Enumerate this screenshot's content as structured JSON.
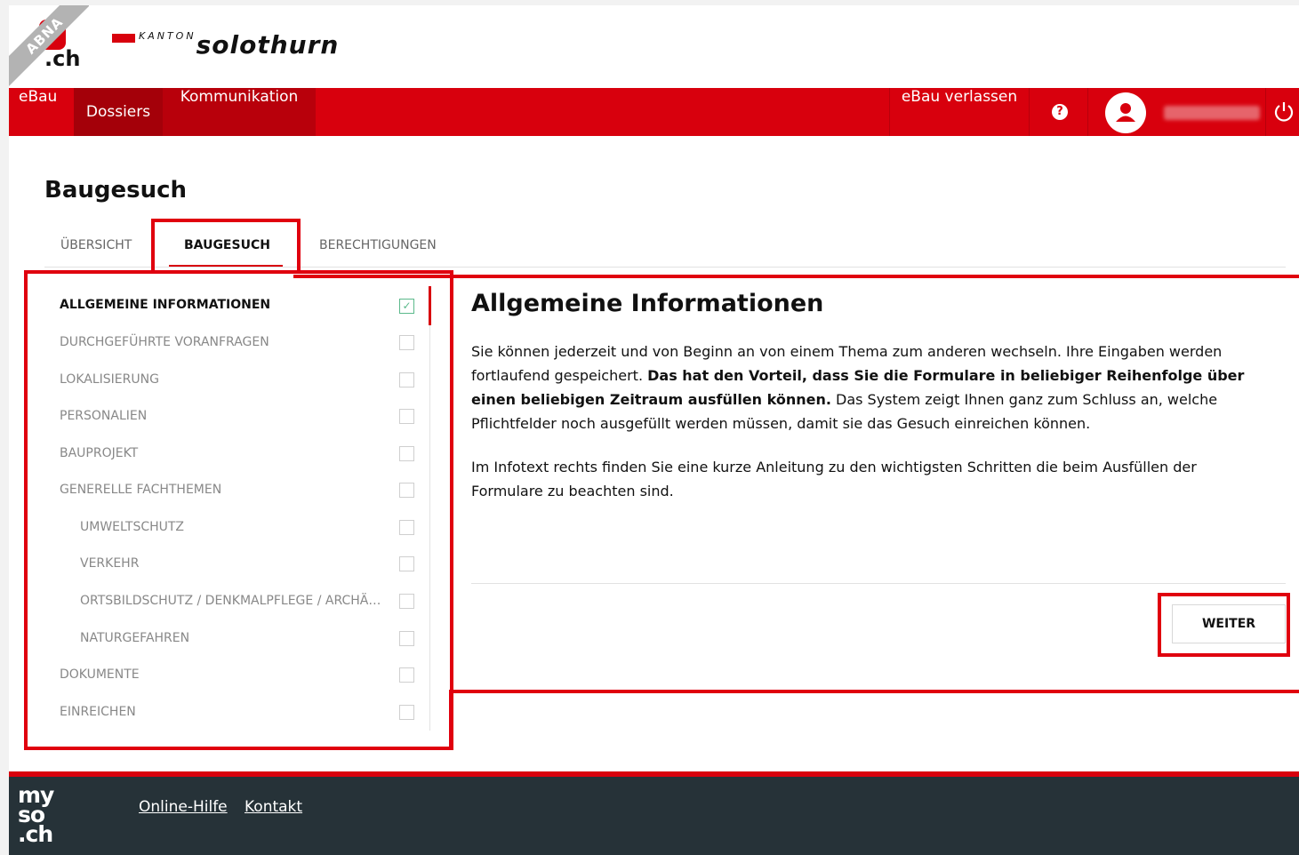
{
  "header": {
    "ribbon": "ABNA",
    "logo_suffix": ".ch",
    "kanton_small": "KANTON",
    "kanton_name": "solothurn"
  },
  "topnav": {
    "ebau": "eBau",
    "dossiers": "Dossiers",
    "kommunikation": "Kommunikation",
    "leave": "eBau verlassen",
    "help": "?"
  },
  "page": {
    "title": "Baugesuch",
    "tabs": [
      "ÜBERSICHT",
      "BAUGESUCH",
      "BERECHTIGUNGEN"
    ]
  },
  "sidebar": {
    "items": [
      {
        "label": "ALLGEMEINE INFORMATIONEN",
        "checked": true
      },
      {
        "label": "DURCHGEFÜHRTE VORANFRAGEN",
        "checked": false
      },
      {
        "label": "LOKALISIERUNG",
        "checked": false
      },
      {
        "label": "PERSONALIEN",
        "checked": false
      },
      {
        "label": "BAUPROJEKT",
        "checked": false
      },
      {
        "label": "GENERELLE FACHTHEMEN",
        "checked": false
      },
      {
        "label": "UMWELTSCHUTZ",
        "checked": false
      },
      {
        "label": "VERKEHR",
        "checked": false
      },
      {
        "label": "ORTSBILDSCHUTZ / DENKMALPFLEGE / ARCHÄ…",
        "checked": false
      },
      {
        "label": "NATURGEFAHREN",
        "checked": false
      },
      {
        "label": "DOKUMENTE",
        "checked": false
      },
      {
        "label": "EINREICHEN",
        "checked": false
      }
    ]
  },
  "content": {
    "title": "Allgemeine Informationen",
    "p1_start": "Sie können jederzeit und von Beginn an von einem Thema zum anderen wechseln. Ihre Eingaben werden fortlaufend gespeichert. ",
    "p1_bold": "Das hat den Vorteil, dass Sie die Formulare in beliebiger Reihenfolge über einen beliebigen Zeitraum ausfüllen können.",
    "p1_end": " Das System zeigt Ihnen ganz zum Schluss an, welche Pflichtfelder noch ausgefüllt werden müssen, damit sie das Gesuch einreichen können.",
    "p2": "Im Infotext rechts finden Sie eine kurze Anleitung zu den wichtigsten Schritten die beim Ausfüllen der Formulare zu beachten sind.",
    "next_button": "WEITER"
  },
  "footer": {
    "logo": "my so .ch",
    "links": [
      "Online-Hilfe",
      "Kontakt"
    ]
  },
  "colors": {
    "brand_red": "#d8000d",
    "footer_bg": "#263238",
    "check_green": "#5bb98b"
  }
}
